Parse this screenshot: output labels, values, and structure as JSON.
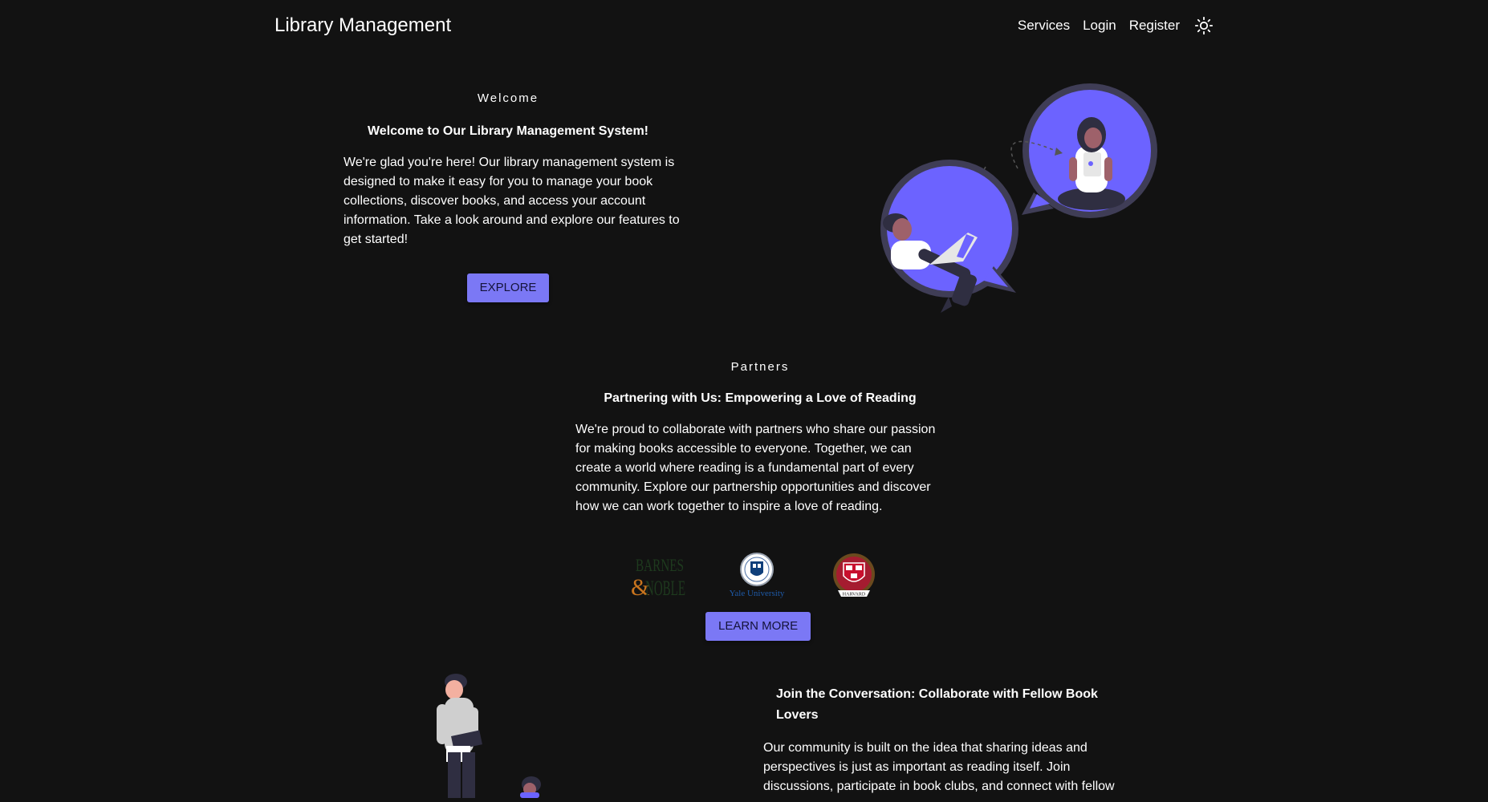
{
  "nav": {
    "brand": "Library Management",
    "links": [
      "Services",
      "Login",
      "Register"
    ],
    "theme_icon": "sun-icon"
  },
  "welcome": {
    "eyebrow": "Welcome",
    "heading": "Welcome to Our Library Management System!",
    "body": "We're glad you're here! Our library management system is designed to make it easy for you to manage your book collections, discover books, and access your account information. Take a look around and explore our features to get started!",
    "button": "EXPLORE"
  },
  "partners": {
    "eyebrow": "Partners",
    "heading": "Partnering with Us: Empowering a Love of Reading",
    "body": "We're proud to collaborate with partners who share our passion for making books accessible to everyone. Together, we can create a world where reading is a fundamental part of every community. Explore our partnership opportunities and discover how we can work together to inspire a love of reading.",
    "logos": {
      "barnes_top": "BARNES",
      "barnes_amp": "&",
      "barnes_bottom": "NOBLE",
      "yale_text": "Yale University",
      "harvard_ribbon": "HARVARD"
    },
    "button": "LEARN MORE"
  },
  "community": {
    "heading": "Join the Conversation: Collaborate with Fellow Book Lovers",
    "body": "Our community is built on the idea that sharing ideas and perspectives is just as important as reading itself. Join discussions, participate in book clubs, and connect with fellow"
  },
  "colors": {
    "background": "#121212",
    "accent": "#7b78f5",
    "illustration_purple": "#6c63ff",
    "illustration_dark": "#2f2e41"
  }
}
